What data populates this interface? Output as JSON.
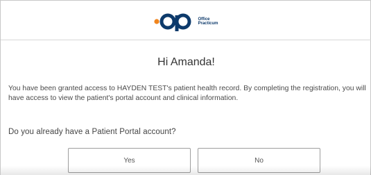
{
  "brand": {
    "logo_text_line1": "Office",
    "logo_text_line2": "Practicum",
    "colors": {
      "logo_orange": "#f0851e",
      "logo_navy": "#0d3a6b"
    }
  },
  "main": {
    "greeting": "Hi Amanda!",
    "body_text": "You have been granted access to HAYDEN TEST's patient health record.   By completing the registration, you will have access to view the patient's portal account and clinical information.",
    "question": "Do you already have a Patient Portal account?",
    "buttons": {
      "yes_label": "Yes",
      "no_label": "No"
    }
  }
}
